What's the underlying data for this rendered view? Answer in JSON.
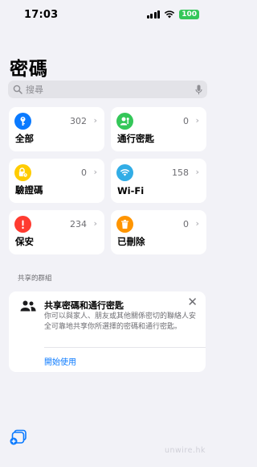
{
  "status_bar": {
    "time": "17:03",
    "battery": "100",
    "battery_color": "#34c759"
  },
  "page_title": "密碼",
  "search": {
    "placeholder": "搜尋"
  },
  "categories": [
    {
      "label": "全部",
      "count": "302",
      "icon": "key-icon",
      "color": "#0a7aff"
    },
    {
      "label": "通行密匙",
      "count": "0",
      "icon": "person-key-icon",
      "color": "#34c759"
    },
    {
      "label": "驗證碼",
      "count": "0",
      "icon": "lock-clock-icon",
      "color": "#ffcc00"
    },
    {
      "label": "Wi-Fi",
      "count": "158",
      "icon": "wifi-icon",
      "color": "#32ade6"
    },
    {
      "label": "保安",
      "count": "234",
      "icon": "exclamation-icon",
      "color": "#ff3b30"
    },
    {
      "label": "已刪除",
      "count": "0",
      "icon": "trash-icon",
      "color": "#ff9500"
    }
  ],
  "shared_groups": {
    "section_label": "共享的群組",
    "card": {
      "title": "共享密碼和通行密匙",
      "description": "你可以與家人、朋友或其他關係密切的聯絡人安全可靠地共享你所選擇的密碼和通行密匙。",
      "action": "開始使用"
    }
  },
  "watermark": "unwire.hk"
}
